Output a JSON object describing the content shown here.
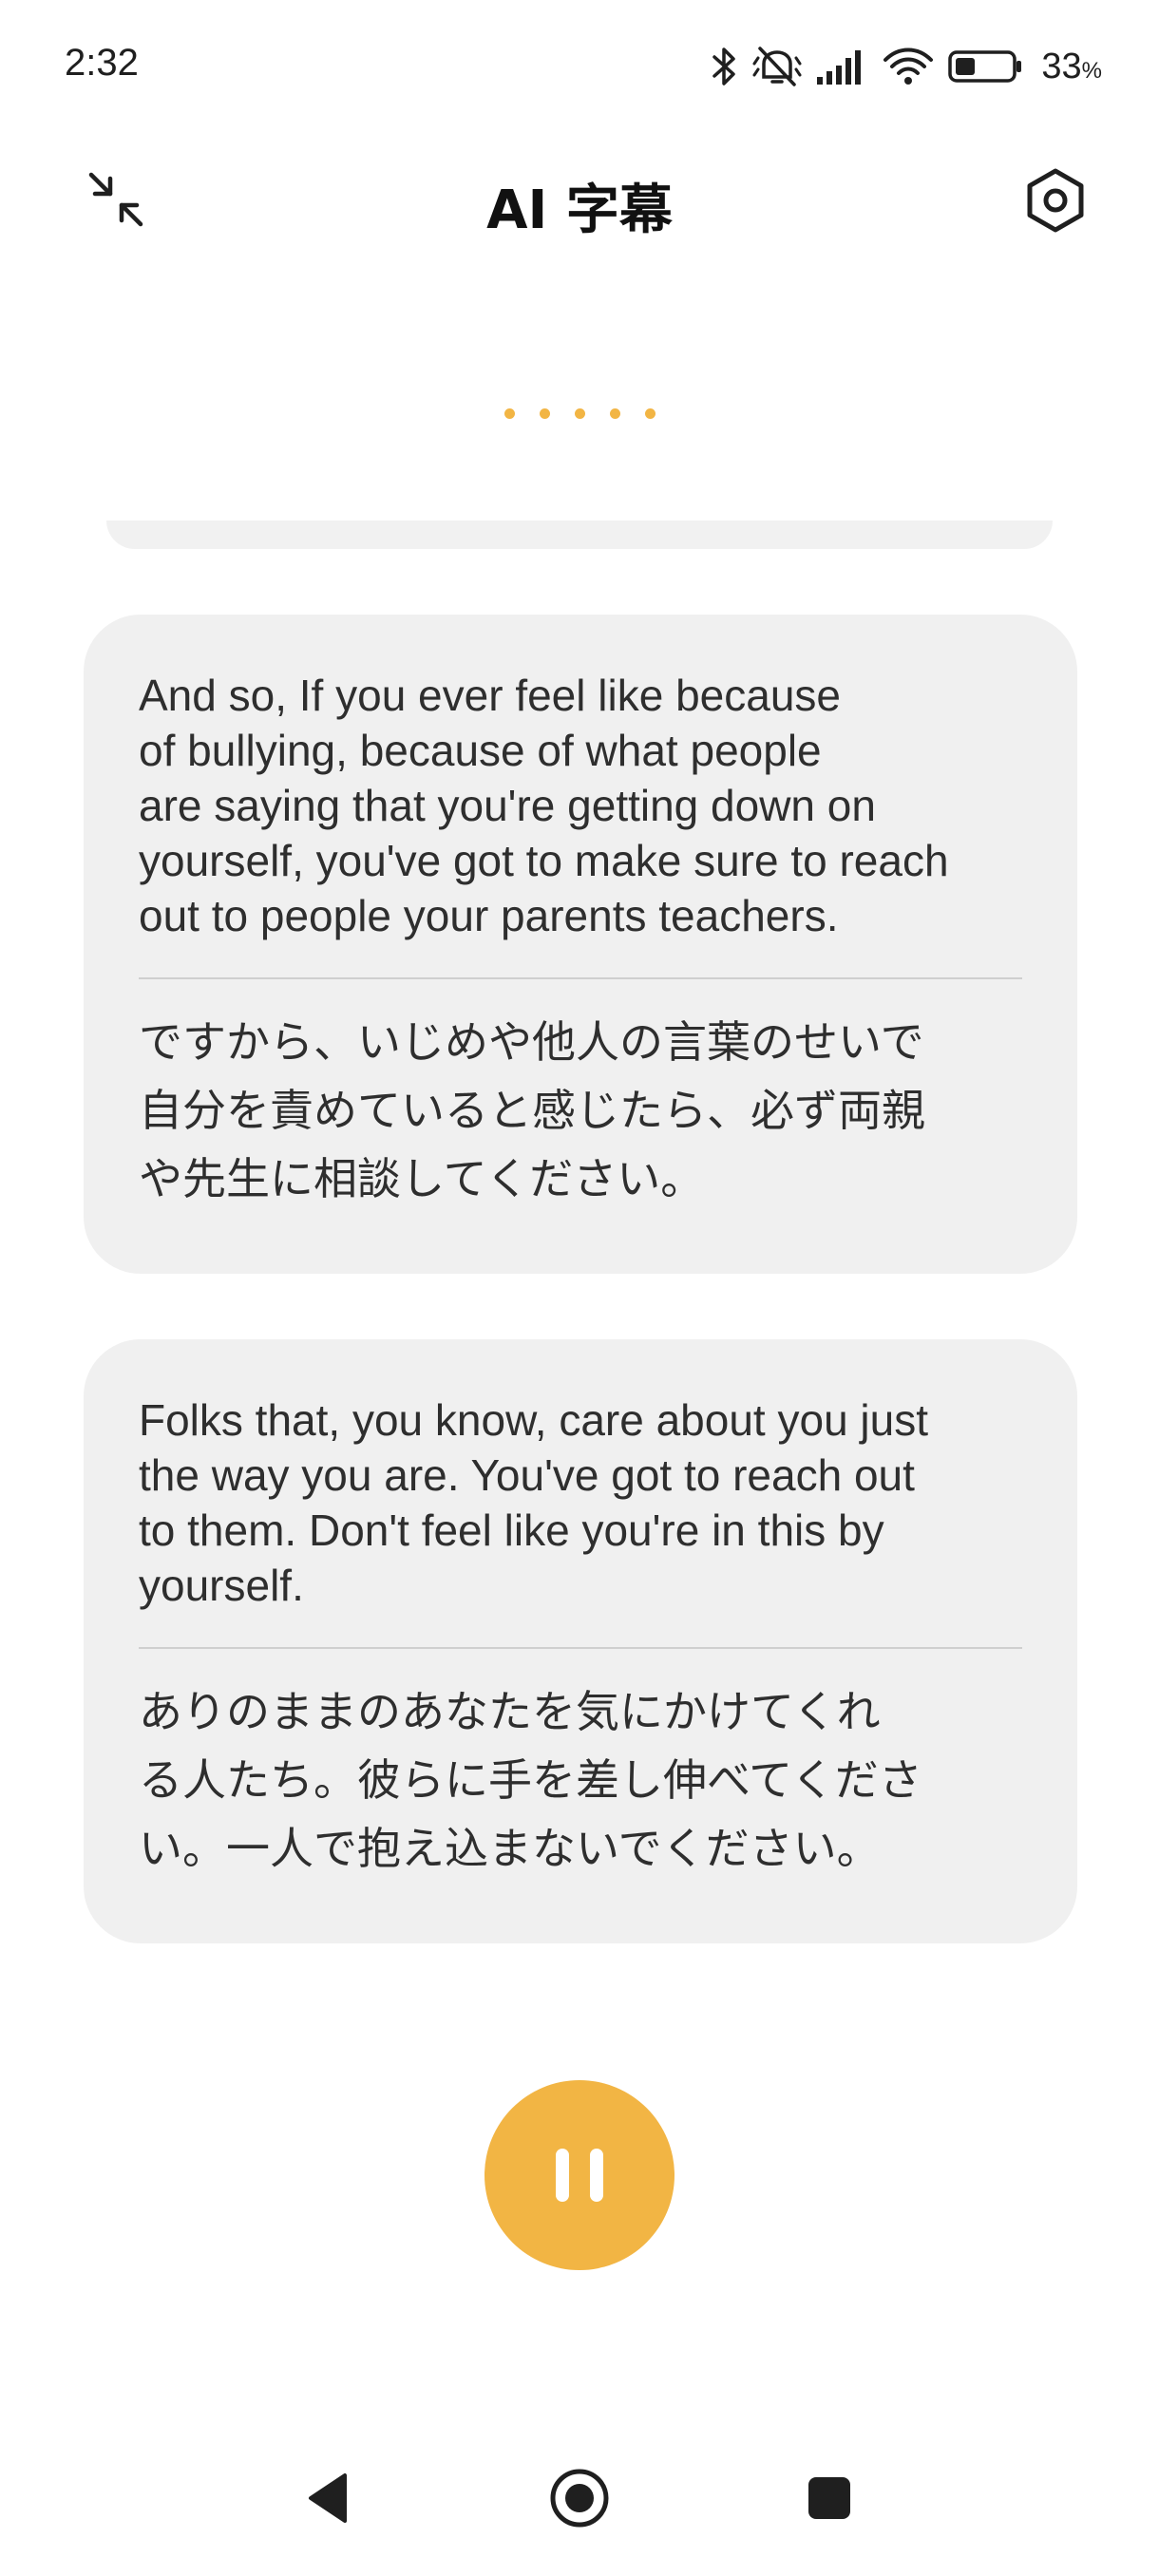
{
  "status_bar": {
    "time": "2:32",
    "battery_percent_value": "33",
    "battery_percent_sign": "%",
    "battery_level": 0.33
  },
  "header": {
    "title": "AI 字幕"
  },
  "colors": {
    "accent": "#f2b544",
    "card_background": "#f0f0f0"
  },
  "subtitles": [
    {
      "source": "And so, If you ever feel like because\nof bullying, because of what people\nare saying that you're getting down on\nyourself, you've got to make sure to reach\nout to people your parents teachers.",
      "translation": "ですから、いじめや他人の言葉のせいで\n自分を責めていると感じたら、必ず両親\nや先生に相談してください。"
    },
    {
      "source": "Folks that, you know, care about you just\nthe way you are. You've got to reach out\nto them. Don't feel like you're in this by\nyourself.",
      "translation": "ありのままのあなたを気にかけてくれ\nる人たち。彼らに手を差し伸べてくださ\nい。一人で抱え込まないでください。"
    }
  ],
  "icons": {
    "collapse": "collapse-arrows-icon",
    "settings": "hexagon-settings-icon",
    "pause": "pause-icon",
    "back": "triangle-back-icon",
    "home": "circle-home-icon",
    "recents": "square-recents-icon"
  }
}
